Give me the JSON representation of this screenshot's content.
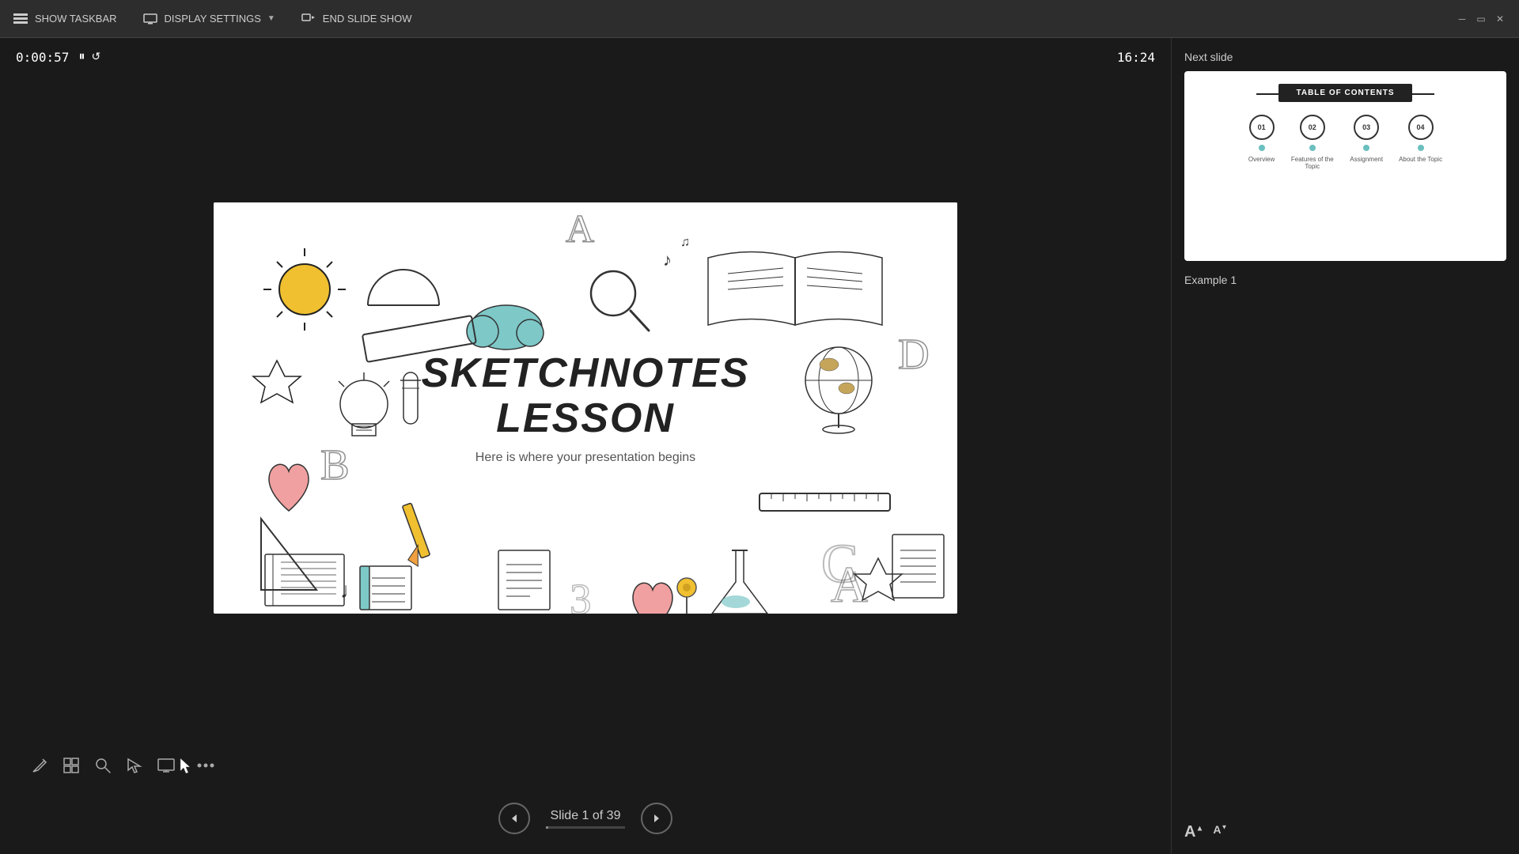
{
  "toolbar": {
    "show_taskbar": "SHOW TASKBAR",
    "display_settings": "DISPLAY SETTINGS",
    "end_slide_show": "END SLIDE SHOW"
  },
  "timer": {
    "elapsed": "0:00:57",
    "clock": "16:24"
  },
  "slide": {
    "title_line1": "SKETCHNOTES",
    "title_line2": "LESSON",
    "subtitle": "Here is where your presentation begins"
  },
  "navigation": {
    "counter": "Slide 1 of 39",
    "current": 1,
    "total": 39
  },
  "right_panel": {
    "next_slide_label": "Next slide",
    "example_label": "Example 1",
    "toc": {
      "title": "TABLE OF CONTENTS",
      "items": [
        {
          "number": "01",
          "label": "Overview",
          "dot_color": "#6bbfbf"
        },
        {
          "number": "02",
          "label": "Features of the Topic",
          "dot_color": "#6bbfbf"
        },
        {
          "number": "03",
          "label": "Assignment",
          "dot_color": "#6bbfbf"
        },
        {
          "number": "04",
          "label": "About the Topic",
          "dot_color": "#6bbfbf"
        }
      ]
    }
  },
  "tools": {
    "pen": "✏",
    "grid": "⊞",
    "search": "🔍",
    "pointer": "↗",
    "screen": "▭",
    "more": "⋯"
  },
  "font_controls": {
    "increase": "A",
    "decrease": "A"
  }
}
